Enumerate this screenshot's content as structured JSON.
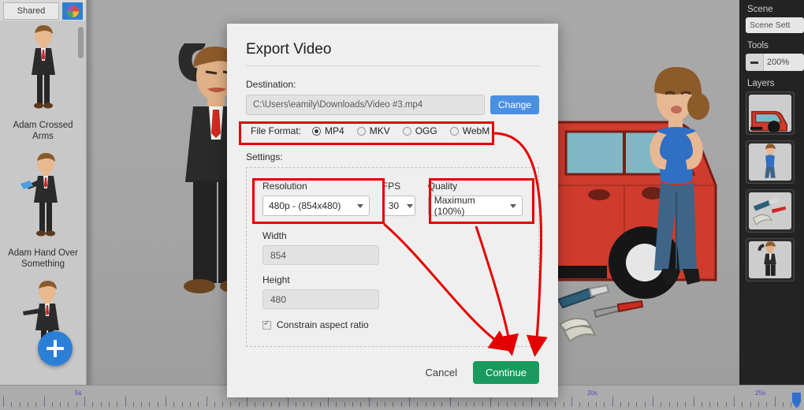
{
  "app": {
    "left_sidebar": {
      "tab_label": "Shared",
      "tab_icon": "color-wheel-icon",
      "characters": [
        {
          "label": "Adam Crossed Arms",
          "art": "man-suit-crossed-arms"
        },
        {
          "label": "Adam Hand Over Something",
          "art": "man-suit-handing-tablet"
        },
        {
          "label": "",
          "art": "man-suit-pointing"
        }
      ],
      "add_button_icon": "plus-icon"
    },
    "right_sidebar": {
      "scene_heading": "Scene",
      "scene_settings_label": "Scene Sett",
      "tools_heading": "Tools",
      "zoom_minus_icon": "minus-icon",
      "zoom_value": "200%",
      "layers_heading": "Layers",
      "layers": [
        {
          "name": "red-car-layer"
        },
        {
          "name": "woman-layer"
        },
        {
          "name": "tools-layer"
        },
        {
          "name": "man-layer"
        }
      ]
    },
    "timeline": {
      "labels": [
        "5s",
        "20s",
        "25s"
      ],
      "label_positions": [
        48,
        363,
        466
      ]
    }
  },
  "dialog": {
    "title": "Export Video",
    "destination": {
      "label": "Destination:",
      "value": "C:\\Users\\eamily\\Downloads/Video #3.mp4",
      "change_label": "Change"
    },
    "file_format": {
      "label": "File Format:",
      "options": [
        {
          "label": "MP4",
          "selected": true
        },
        {
          "label": "MKV",
          "selected": false
        },
        {
          "label": "OGG",
          "selected": false
        },
        {
          "label": "WebM",
          "selected": false
        }
      ]
    },
    "settings": {
      "label": "Settings:",
      "resolution": {
        "label": "Resolution",
        "value": "480p  -  (854x480)"
      },
      "fps": {
        "label": "FPS",
        "value": "30"
      },
      "quality": {
        "label": "Quality",
        "value": "Maximum (100%)"
      },
      "width": {
        "label": "Width",
        "value": "854"
      },
      "height": {
        "label": "Height",
        "value": "480"
      },
      "constrain": {
        "label": "Constrain aspect ratio",
        "checked": true
      }
    },
    "actions": {
      "cancel_label": "Cancel",
      "continue_label": "Continue"
    }
  },
  "annotations": {
    "highlight_color": "#e30000",
    "boxes": [
      "file-format-row",
      "resolution-group",
      "quality-group"
    ],
    "arrow_target": "continue-button"
  },
  "colors": {
    "accent_blue": "#4a90e2",
    "continue_green": "#1a9a5e",
    "annotation_red": "#e30000",
    "panel_dark": "#232323"
  }
}
